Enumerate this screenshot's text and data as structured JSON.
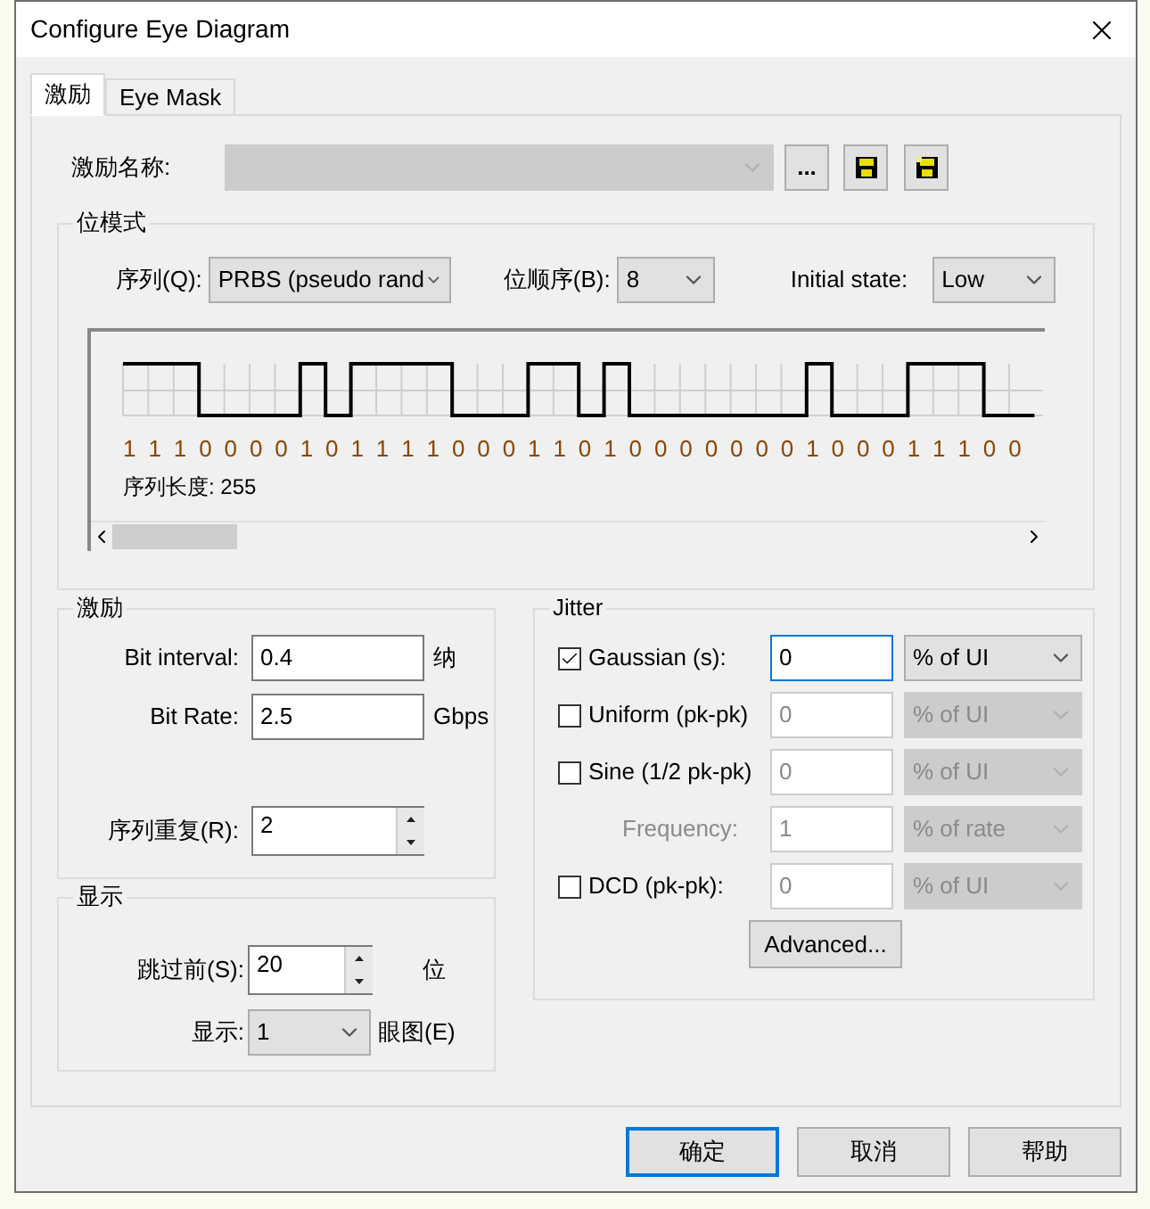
{
  "window": {
    "title": "Configure Eye Diagram"
  },
  "tabs": [
    {
      "label": "激励",
      "selected": true
    },
    {
      "label": "Eye Mask",
      "selected": false
    }
  ],
  "stimulus_name": {
    "label": "激励名称:",
    "browse": "..."
  },
  "bit_pattern": {
    "title": "位模式",
    "sequence": {
      "label": "序列(Q):",
      "value": "PRBS (pseudo rand"
    },
    "bit_order": {
      "label": "位顺序(B):",
      "value": "8"
    },
    "initial_state": {
      "label": "Initial state:",
      "value": "Low"
    },
    "bits": [
      "1",
      "1",
      "1",
      "0",
      "0",
      "0",
      "0",
      "1",
      "0",
      "1",
      "1",
      "1",
      "1",
      "0",
      "0",
      "0",
      "1",
      "1",
      "0",
      "1",
      "0",
      "0",
      "0",
      "0",
      "0",
      "0",
      "0",
      "1",
      "0",
      "0",
      "0",
      "1",
      "1",
      "1",
      "0",
      "0"
    ],
    "length": "序列长度: 255"
  },
  "stimulus": {
    "title": "激励",
    "fields": [
      {
        "kind": "text",
        "label": "Bit interval:",
        "value": "0.4",
        "unit": "纳"
      },
      {
        "kind": "text",
        "label": "Bit Rate:",
        "value": "2.5",
        "unit": "Gbps"
      },
      {
        "kind": "spin",
        "label": "序列重复(R):",
        "value": "2"
      }
    ]
  },
  "display": {
    "title": "显示",
    "skip": {
      "label": "跳过前(S):",
      "value": "20",
      "unit": "位"
    },
    "show": {
      "label": "显示:",
      "value": "1",
      "unit": "眼图(E)"
    }
  },
  "jitter": {
    "title": "Jitter",
    "rows": [
      {
        "kind": "check",
        "label": "Gaussian (s):",
        "checked": true,
        "value": "0",
        "unit": "% of UI",
        "disabled": false,
        "focused": true
      },
      {
        "kind": "check",
        "label": "Uniform (pk-pk)",
        "checked": false,
        "value": "0",
        "unit": "% of UI",
        "disabled": true,
        "focused": false
      },
      {
        "kind": "check",
        "label": "Sine (1/2 pk-pk)",
        "checked": false,
        "value": "0",
        "unit": "% of UI",
        "disabled": true,
        "focused": false
      },
      {
        "kind": "sub",
        "label": "Frequency:",
        "value": "1",
        "unit": "% of rate",
        "disabled": true,
        "focused": false
      },
      {
        "kind": "check",
        "label": "DCD (pk-pk):",
        "checked": false,
        "value": "0",
        "unit": "% of UI",
        "disabled": true,
        "focused": false
      }
    ],
    "advanced": "Advanced..."
  },
  "buttons": [
    {
      "label": "确定",
      "default": true
    },
    {
      "label": "取消",
      "default": false
    },
    {
      "label": "帮助",
      "default": false
    }
  ]
}
